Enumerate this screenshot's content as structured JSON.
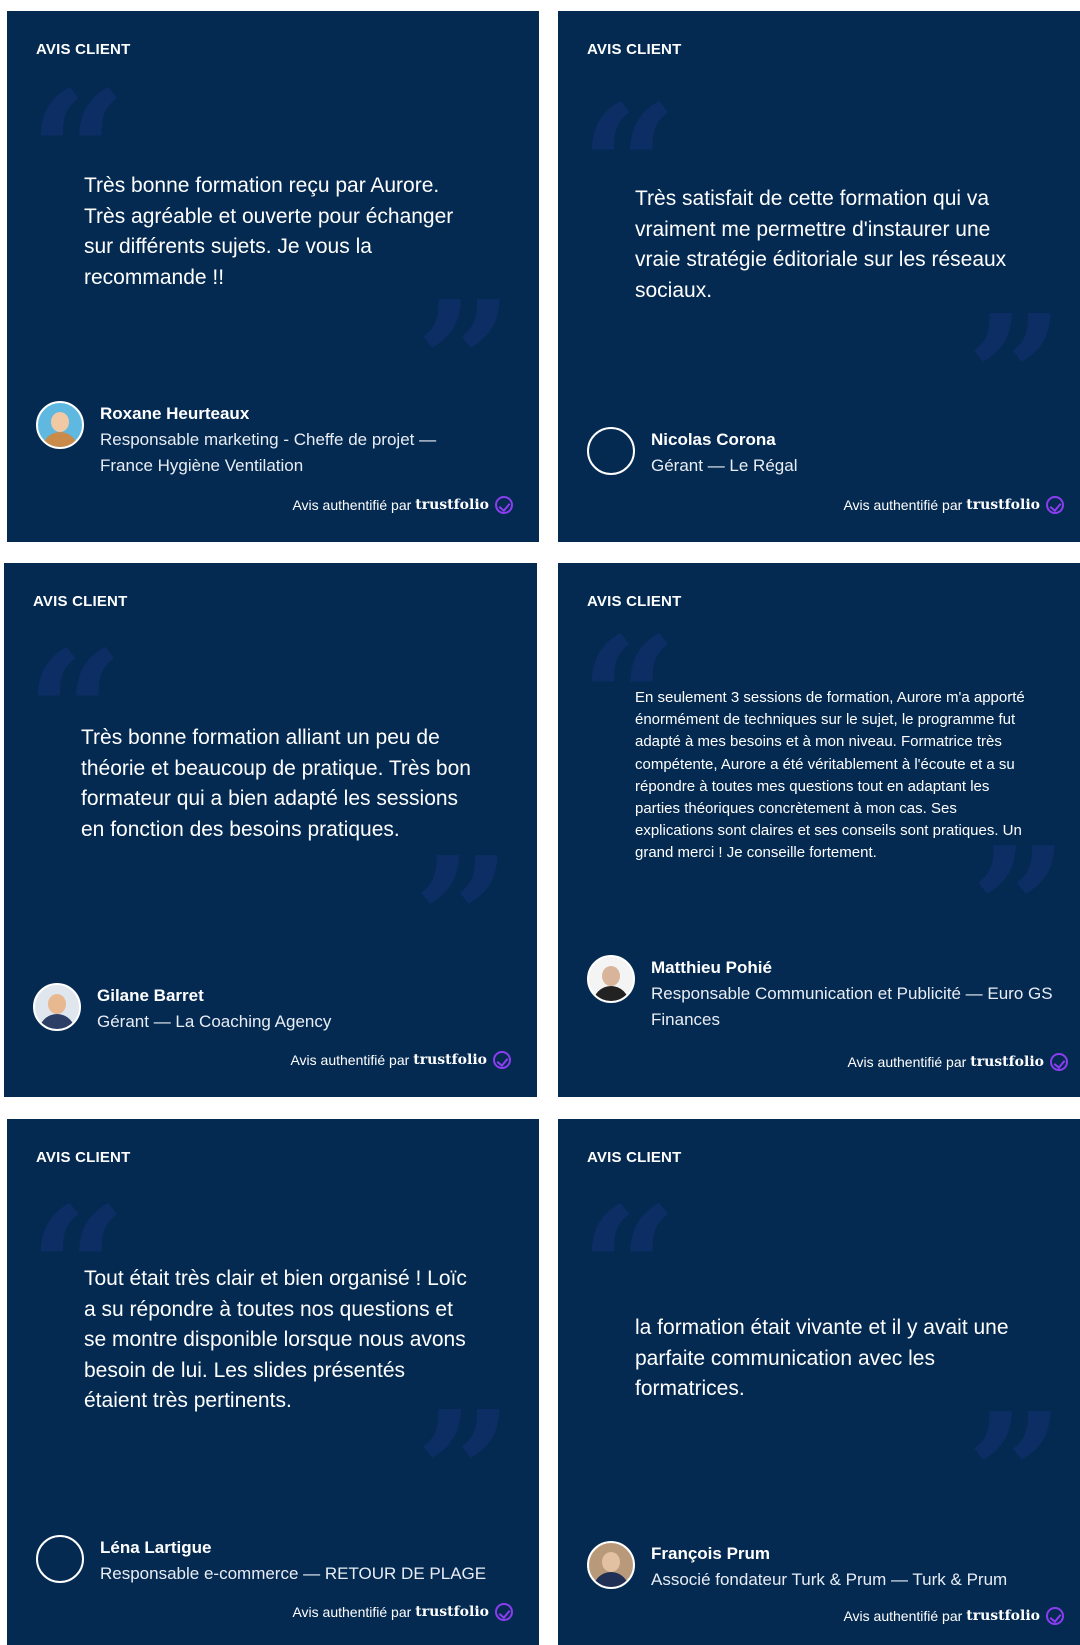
{
  "label": "AVIS CLIENT",
  "verified_prefix": "Avis authentifié par",
  "verified_brand": "trustfolio",
  "colors": {
    "card_bg": "#042a51",
    "quote_mark": "#0d2e64",
    "check": "#8b3df0"
  },
  "cards": [
    {
      "quote": "Très bonne formation reçu par Aurore. Très agréable et ouverte pour échanger sur différents sujets. Je vous la recommande !!",
      "name": "Roxane Heurteaux",
      "role": "Responsable marketing - Cheffe de projet — France Hygiène Ventilation"
    },
    {
      "quote": "Très satisfait de cette formation qui va vraiment me permettre d'instaurer une vraie stratégie éditoriale sur les réseaux sociaux.",
      "name": "Nicolas Corona",
      "role": "Gérant — Le Régal"
    },
    {
      "quote": "Très bonne formation alliant un peu de théorie et beaucoup de pratique. Très bon formateur qui a bien adapté les sessions en fonction des besoins pratiques.",
      "name": "Gilane Barret",
      "role": "Gérant — La Coaching Agency"
    },
    {
      "quote": "En seulement 3 sessions de formation, Aurore m'a apporté énormément de techniques sur le sujet, le programme fut adapté à mes besoins et à mon niveau. Formatrice très compétente, Aurore a été véritablement à l'écoute et a su répondre à toutes mes questions tout en adaptant les parties théoriques concrètement à mon cas. Ses explications sont claires et ses conseils sont pratiques. Un grand merci ! Je conseille fortement.",
      "name": "Matthieu Pohié",
      "role": "Responsable Communication et Publicité — Euro GS Finances"
    },
    {
      "quote": "Tout était très clair et bien organisé ! Loïc a su répondre à toutes nos questions et se montre disponible lorsque nous avons besoin de lui. Les slides présentés étaient très pertinents.",
      "name": "Léna Lartigue",
      "role": "Responsable e-commerce — RETOUR DE PLAGE"
    },
    {
      "quote": "la formation était vivante et il y avait une parfaite communication avec les formatrices.",
      "name": "François Prum",
      "role": "Associé fondateur Turk & Prum — Turk & Prum"
    }
  ]
}
